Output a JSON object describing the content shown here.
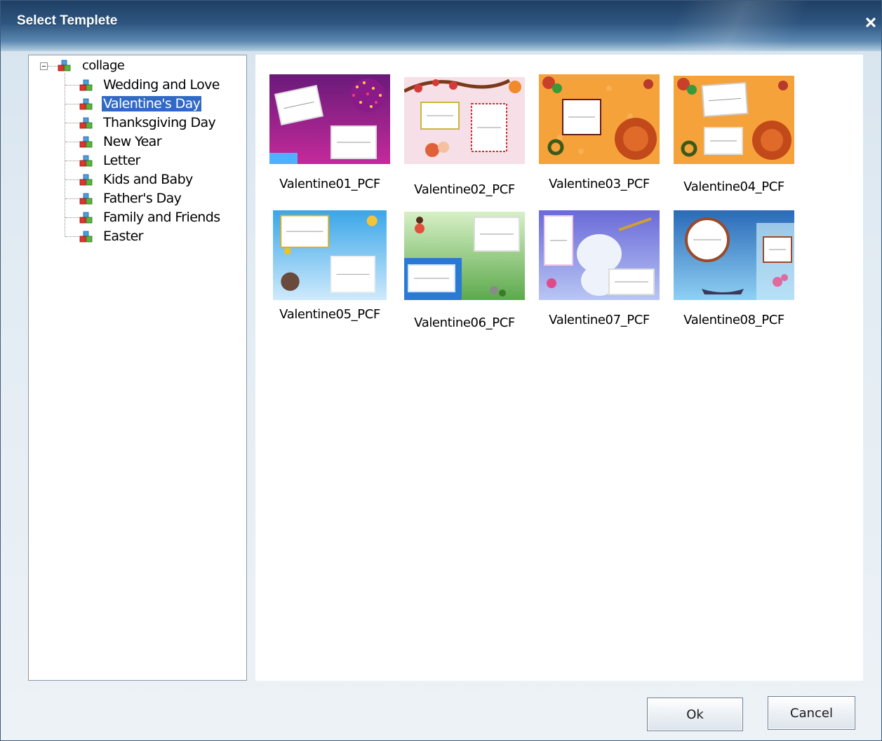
{
  "window": {
    "title": "Select Templete"
  },
  "tree": {
    "root": {
      "label": "collage"
    },
    "items": [
      {
        "label": "Wedding and Love",
        "selected": false
      },
      {
        "label": "Valentine's Day",
        "selected": true
      },
      {
        "label": "Thanksgiving Day",
        "selected": false
      },
      {
        "label": "New Year",
        "selected": false
      },
      {
        "label": "Letter",
        "selected": false
      },
      {
        "label": "Kids and Baby",
        "selected": false
      },
      {
        "label": "Father's Day",
        "selected": false
      },
      {
        "label": "Family and Friends",
        "selected": false
      },
      {
        "label": "Easter",
        "selected": false
      }
    ]
  },
  "templates": [
    {
      "label": "Valentine01_PCF",
      "theme": "purple-hearts"
    },
    {
      "label": "Valentine02_PCF",
      "theme": "pink-flowers"
    },
    {
      "label": "Valentine03_PCF",
      "theme": "orange-turkey"
    },
    {
      "label": "Valentine04_PCF",
      "theme": "orange-turkey-two-frames"
    },
    {
      "label": "Valentine05_PCF",
      "theme": "blue-sky"
    },
    {
      "label": "Valentine06_PCF",
      "theme": "green-field"
    },
    {
      "label": "Valentine07_PCF",
      "theme": "blue-bear"
    },
    {
      "label": "Valentine08_PCF",
      "theme": "sea-boat"
    }
  ],
  "buttons": {
    "ok": "Ok",
    "cancel": "Cancel"
  },
  "colors": {
    "selection": "#3169c6",
    "titlebar_dark": "#1f3f64",
    "titlebar_light": "#b5cde0"
  }
}
